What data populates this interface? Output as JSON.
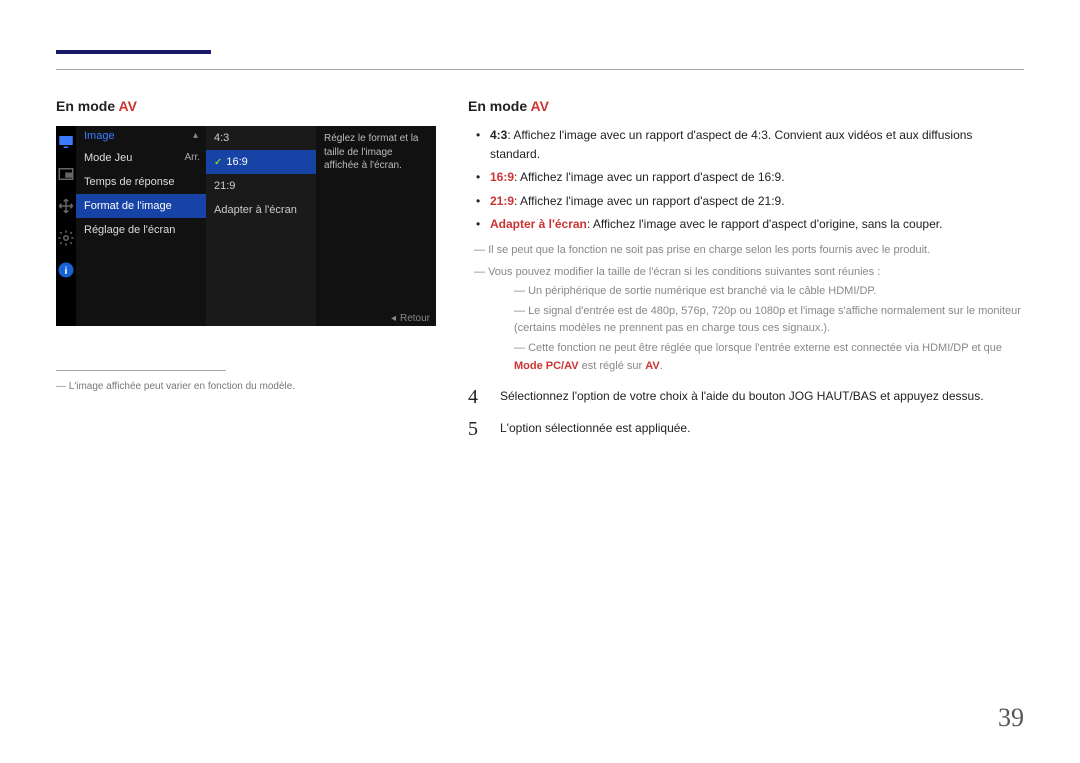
{
  "page_number": "39",
  "header": {
    "left_title_prefix": "En mode ",
    "left_title_em": "AV",
    "right_title_prefix": "En mode ",
    "right_title_em": "AV"
  },
  "osd": {
    "panel_title": "Image",
    "rows": [
      {
        "label": "Mode Jeu",
        "value": "Arr."
      },
      {
        "label": "Temps de réponse",
        "value": ""
      },
      {
        "label": "Format de l'image",
        "value": ""
      },
      {
        "label": "Réglage de l'écran",
        "value": ""
      }
    ],
    "sub_options": [
      "4:3",
      "16:9",
      "21:9",
      "Adapter à l'écran"
    ],
    "selected_sub": "16:9",
    "help_text": "Réglez le format et la taille de l'image affichée à l'écran.",
    "footer": "Retour"
  },
  "caption": "L'image affichée peut varier en fonction du modèle.",
  "bullets": [
    {
      "lead": "4:3",
      "text": ": Affichez l'image avec un rapport d'aspect de 4:3. Convient aux vidéos et aux diffusions standard."
    },
    {
      "lead": "16:9",
      "text": ": Affichez l'image avec un rapport d'aspect de 16:9."
    },
    {
      "lead": "21:9",
      "text": ": Affichez l'image avec un rapport d'aspect de 21:9."
    },
    {
      "lead": "Adapter à l'écran",
      "text": ": Affichez l'image avec le rapport d'aspect d'origine, sans la couper."
    }
  ],
  "notes": {
    "n1": "Il se peut que la fonction ne soit pas prise en charge selon les ports fournis avec le produit.",
    "n2": "Vous pouvez modifier la taille de l'écran si les conditions suivantes sont réunies :",
    "s1": "Un périphérique de sortie numérique est branché via le câble HDMI/DP.",
    "s2": "Le signal d'entrée est de 480p, 576p, 720p ou 1080p et l'image s'affiche normalement sur le moniteur (certains modèles ne prennent pas en charge tous ces signaux.).",
    "s3_a": "Cette fonction ne peut être réglée que lorsque l'entrée externe est connectée via HDMI/DP et que ",
    "s3_b": "Mode PC/AV",
    "s3_c": " est réglé sur ",
    "s3_d": "AV",
    "s3_e": "."
  },
  "steps": {
    "4": "Sélectionnez l'option de votre choix à l'aide du bouton JOG HAUT/BAS et appuyez dessus.",
    "5": "L'option sélectionnée est appliquée."
  }
}
